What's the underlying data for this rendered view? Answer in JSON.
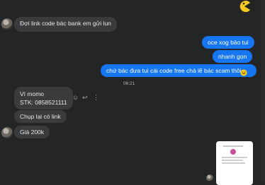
{
  "messages": {
    "m1": "Đợi link code bác bank em gửi lun",
    "m2": "oce xog bảo tui",
    "m3": "nhanh gọn",
    "m4": "chứ bác đưa tui cái code free chả lẽ bác scam thôi",
    "timestamp": "06:21",
    "m5_line1": "Ví momo",
    "m5_line2": "STK: 0858521111",
    "m6": "Chụp lại có link",
    "m7": "Giá 200k"
  },
  "icons": {
    "top_right": "pacman-emoji-icon",
    "reply_emoji": "laughing-emoji-icon",
    "react": "smiley-icon",
    "reply": "reply-arrow-icon",
    "more": "more-vertical-icon"
  },
  "colors": {
    "background": "#242526",
    "incoming_bubble": "#3a3b3c",
    "outgoing_bubble": "#1675f0"
  }
}
